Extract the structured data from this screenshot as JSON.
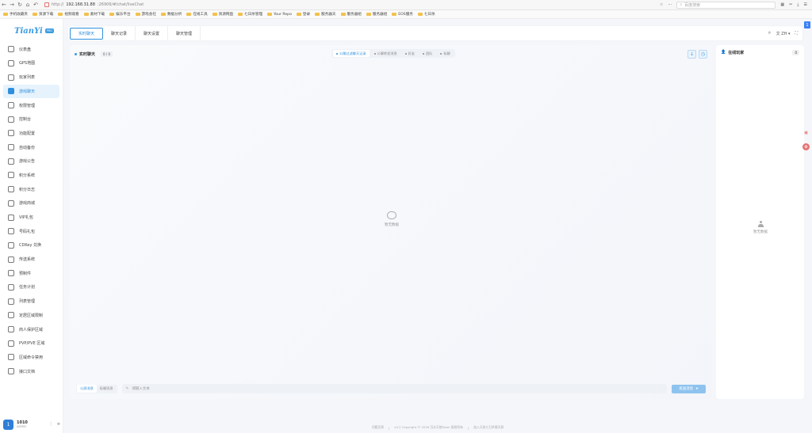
{
  "browser": {
    "url_prefix": "http://",
    "url_host": "192.168.31.88",
    "url_rest": ":26906/#/chat/liveChat",
    "search_placeholder": "百度搜索"
  },
  "bookmarks": [
    "手机收藏夹",
    "资源下载",
    "视频观看",
    "素材下载",
    "娱乐平台",
    "游戏会社",
    "数据分析",
    "在线工具",
    "资源网盘",
    "七日杀管理",
    "Your Repo",
    "登录",
    "服务器天",
    "服务器组",
    "服务器组",
    "EOS服务",
    "七日杀"
  ],
  "logo": {
    "text": "TianYi",
    "badge": "PRO"
  },
  "sidebar": {
    "items": [
      {
        "label": "仪表盘",
        "icon": "dashboard-icon"
      },
      {
        "label": "GPS地图",
        "icon": "map-icon"
      },
      {
        "label": "玩家列表",
        "icon": "user-icon"
      },
      {
        "label": "游戏聊天",
        "icon": "chat-icon",
        "active": true
      },
      {
        "label": "权限管理",
        "icon": "permission-icon"
      },
      {
        "label": "控制台",
        "icon": "console-icon"
      },
      {
        "label": "功能配置",
        "icon": "settings-icon"
      },
      {
        "label": "自动备份",
        "icon": "backup-icon"
      },
      {
        "label": "游戏公告",
        "icon": "announcement-icon"
      },
      {
        "label": "积分系统",
        "icon": "points-icon"
      },
      {
        "label": "积分日志",
        "icon": "log-icon"
      },
      {
        "label": "游戏商城",
        "icon": "shop-icon"
      },
      {
        "label": "VIP礼包",
        "icon": "vip-icon"
      },
      {
        "label": "号码礼包",
        "icon": "gift-icon"
      },
      {
        "label": "CDKey 兑换",
        "icon": "key-icon"
      },
      {
        "label": "传送系统",
        "icon": "teleport-icon"
      },
      {
        "label": "预制件",
        "icon": "prefab-icon"
      },
      {
        "label": "任务计划",
        "icon": "schedule-icon"
      },
      {
        "label": "列表管理",
        "icon": "list-icon"
      },
      {
        "label": "定居区域限制",
        "icon": "location-icon"
      },
      {
        "label": "商人保护区域",
        "icon": "trader-icon"
      },
      {
        "label": "PVP/PVE 区域",
        "icon": "pvp-icon"
      },
      {
        "label": "区域命令禁用",
        "icon": "zone-icon"
      },
      {
        "label": "接口文档",
        "icon": "doc-icon"
      }
    ]
  },
  "user": {
    "initial": "1",
    "name": "1010",
    "role": "ADMIN"
  },
  "tabs": [
    "实时聊天",
    "聊天记录",
    "聊天设置",
    "聊天管理"
  ],
  "top_tools": {
    "lang": "ZH"
  },
  "corner_badge": "1",
  "chat": {
    "title": "实时聊天",
    "count": "0 / 0",
    "filters": [
      "公聊过滤聊天记录",
      "公聊转发消息",
      "好友",
      "团队",
      "私聊"
    ],
    "empty": "暂无数据"
  },
  "input": {
    "send_tabs": [
      "公屏消息",
      "私聊消息"
    ],
    "placeholder": "请输入文本",
    "send_label": "发送消息"
  },
  "players": {
    "title": "在线玩家",
    "count": "0",
    "empty": "暂无数据"
  },
  "footer": [
    "问题反馈",
    "v4.2 Copyright © 2026 沉水天依Team 版权所有",
    "加入天依七日杀聊天群"
  ]
}
